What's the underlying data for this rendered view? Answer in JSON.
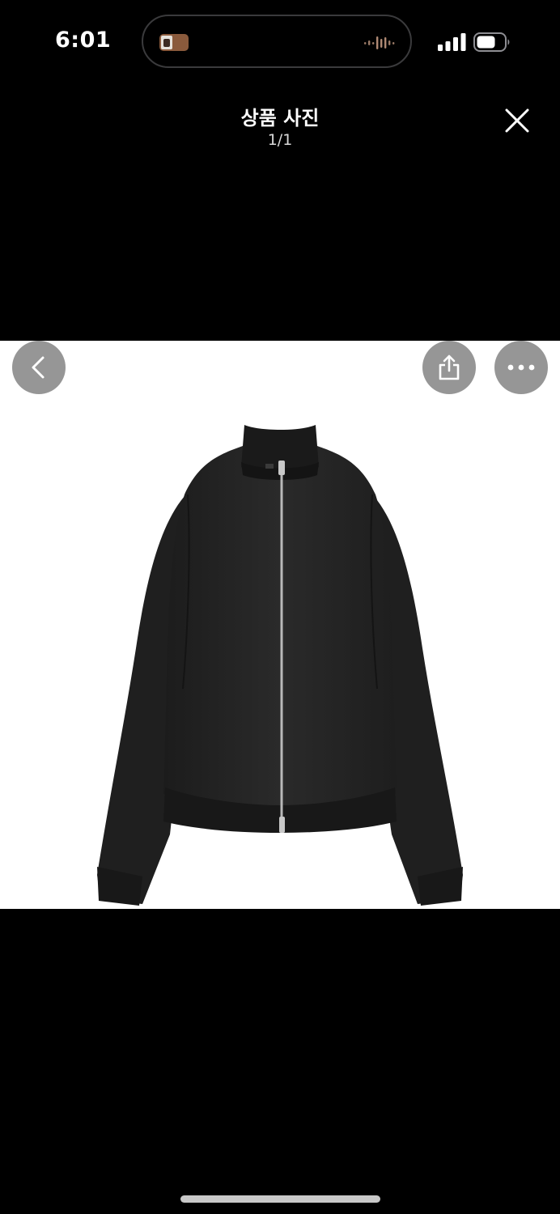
{
  "status_bar": {
    "time": "6:01",
    "icons": {
      "now_playing": "album-artwork-icon",
      "audio": "waveform-icon",
      "signal": "cellular-signal-icon",
      "battery": "battery-icon"
    }
  },
  "header": {
    "title": "상품 사진",
    "counter": "1/1",
    "close_icon": "close-icon"
  },
  "photo": {
    "subject": "black-zip-up-jacket",
    "background_color": "#ffffff",
    "garment_color": "#242424"
  },
  "overlay_buttons": {
    "back_icon": "chevron-left-icon",
    "share_icon": "share-icon",
    "more_icon": "ellipsis-icon"
  },
  "colors": {
    "background": "#000000",
    "text": "#ffffff",
    "overlay_button": "#787878"
  }
}
